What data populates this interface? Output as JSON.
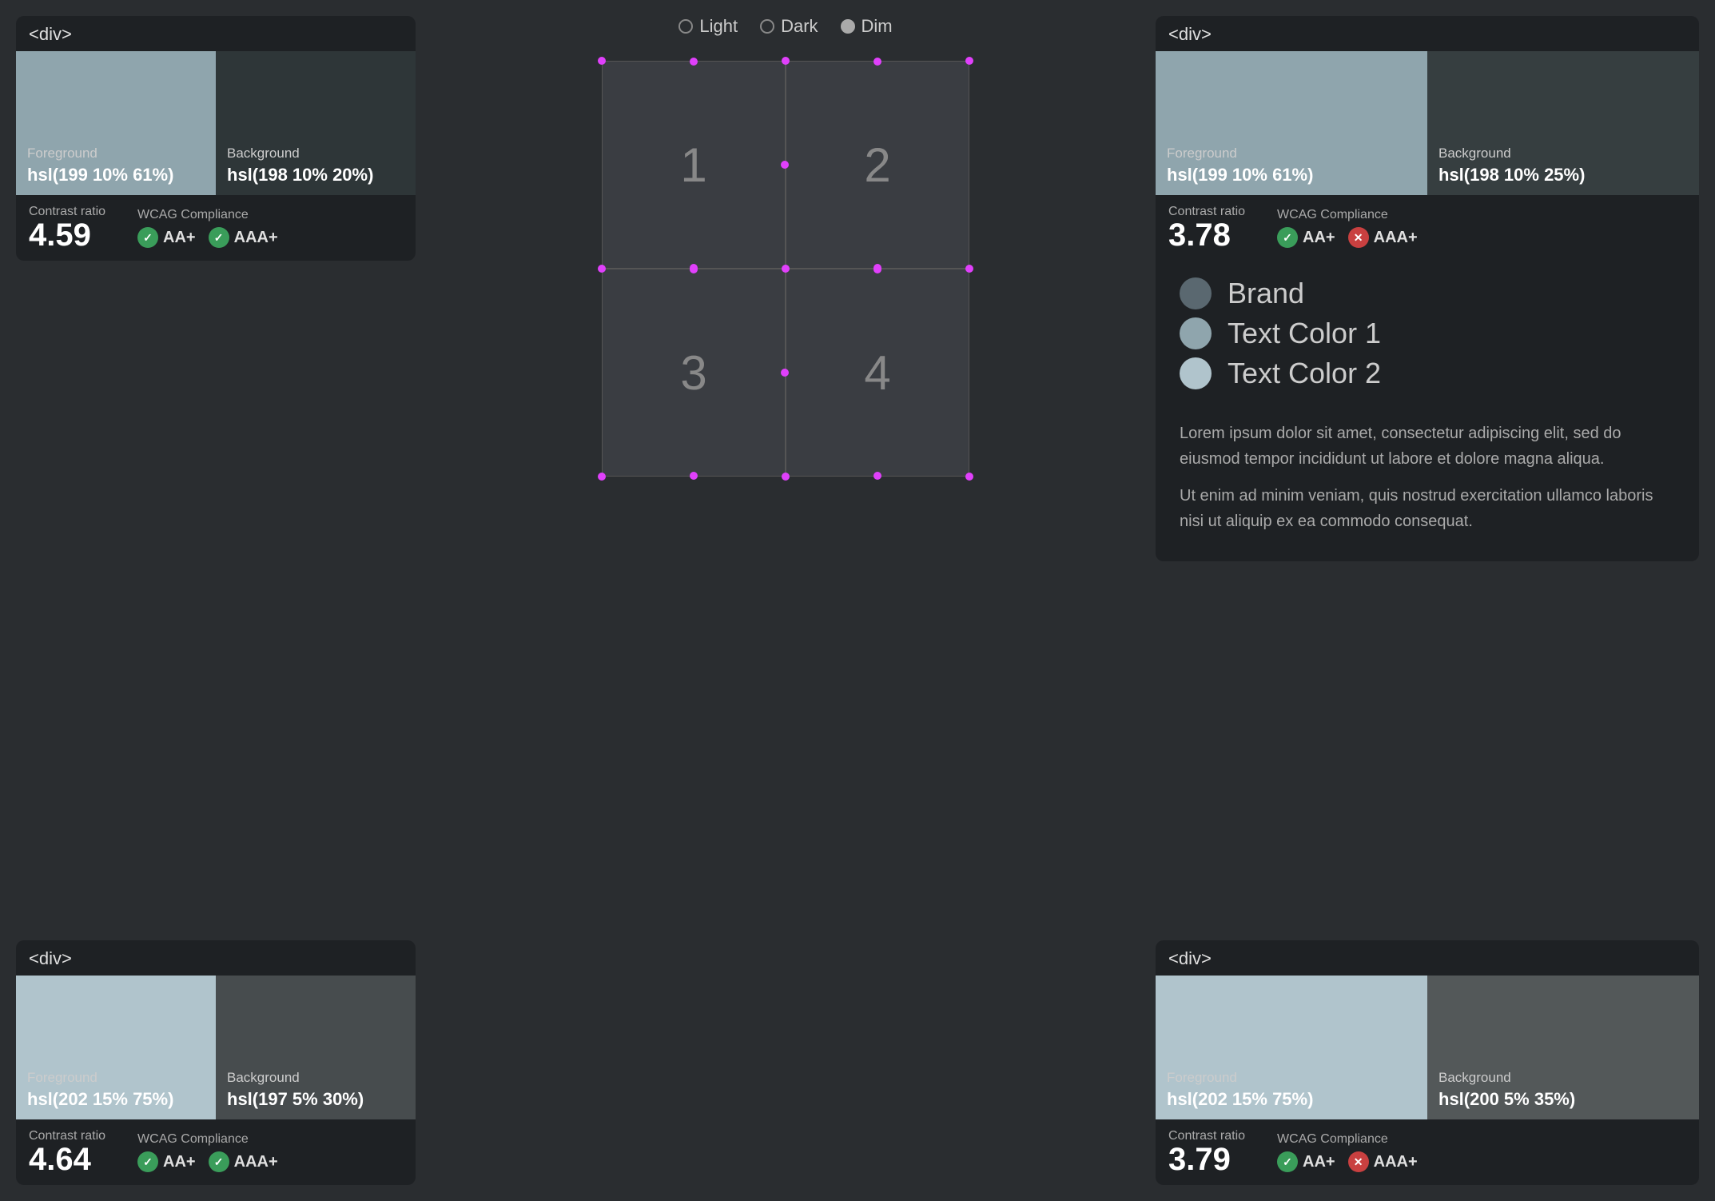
{
  "theme": {
    "options": [
      "Light",
      "Dark",
      "Dim"
    ],
    "selected": "Dim"
  },
  "cards": {
    "top_left": {
      "tag": "<div>",
      "foreground_label": "Foreground",
      "foreground_value": "hsl(199 10% 61%)",
      "foreground_color": "#8fa5ad",
      "background_label": "Background",
      "background_value": "hsl(198 10% 20%)",
      "background_color": "#2e3638",
      "contrast_label": "Contrast ratio",
      "contrast_value": "4.59",
      "wcag_label": "WCAG Compliance",
      "badge_aa": "AA+",
      "badge_aaa": "AAA+",
      "aa_pass": true,
      "aaa_pass": true
    },
    "top_right": {
      "tag": "<div>",
      "foreground_label": "Foreground",
      "foreground_value": "hsl(199 10% 61%)",
      "foreground_color": "#8fa5ad",
      "background_label": "Background",
      "background_value": "hsl(198 10% 25%)",
      "background_color": "#363e40",
      "contrast_label": "Contrast ratio",
      "contrast_value": "3.78",
      "wcag_label": "WCAG Compliance",
      "badge_aa": "AA+",
      "badge_aaa": "AAA+",
      "aa_pass": true,
      "aaa_pass": false
    },
    "bottom_left": {
      "tag": "<div>",
      "foreground_label": "Foreground",
      "foreground_value": "hsl(202 15% 75%)",
      "foreground_color": "#b0c4cc",
      "background_label": "Background",
      "background_value": "hsl(197 5% 30%)",
      "background_color": "#474c4e",
      "contrast_label": "Contrast ratio",
      "contrast_value": "4.64",
      "wcag_label": "WCAG Compliance",
      "badge_aa": "AA+",
      "badge_aaa": "AAA+",
      "aa_pass": true,
      "aaa_pass": true
    },
    "bottom_right": {
      "tag": "<div>",
      "foreground_label": "Foreground",
      "foreground_value": "hsl(202 15% 75%)",
      "foreground_color": "#b0c4cc",
      "background_label": "Background",
      "background_value": "hsl(200 5% 35%)",
      "background_color": "#535859",
      "contrast_label": "Contrast ratio",
      "contrast_value": "3.79",
      "wcag_label": "WCAG Compliance",
      "badge_aa": "AA+",
      "badge_aaa": "AAA+",
      "aa_pass": true,
      "aaa_pass": false
    }
  },
  "grid": {
    "boxes": [
      "1",
      "2",
      "3",
      "4"
    ]
  },
  "legend": {
    "items": [
      {
        "label": "Brand",
        "color": "#5a6870"
      },
      {
        "label": "Text Color 1",
        "color": "#8fa5ad"
      },
      {
        "label": "Text Color 2",
        "color": "#b0c4cc"
      }
    ]
  },
  "lorem": {
    "paragraph1": "Lorem ipsum dolor sit amet, consectetur adipiscing elit, sed do eiusmod tempor incididunt ut labore et dolore magna aliqua.",
    "paragraph2": "Ut enim ad minim veniam, quis nostrud exercitation ullamco laboris nisi ut aliquip ex ea commodo consequat."
  }
}
